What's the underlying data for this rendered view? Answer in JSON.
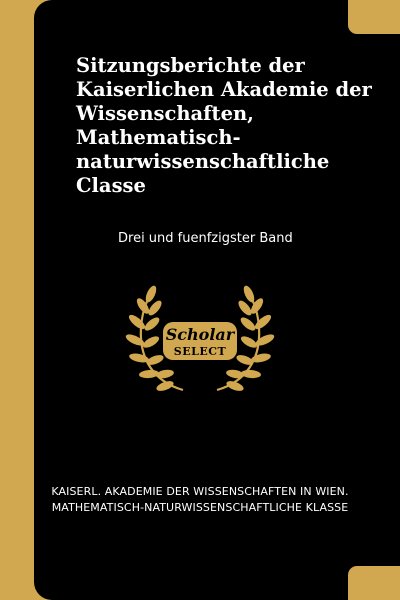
{
  "book": {
    "title": "Sitzungsberichte der\nKaiserlichen Akademie der\nWissenschaften,\nMathematisch-\nnaturwissenschaftliche\nClasse",
    "subtitle": "Drei und fuenfzigster Band",
    "author_line1": "KAISERL. AKADEMIE DER WISSENSCHAFTEN IN WIEN.",
    "author_line2": "MATHEMATISCH-NATURWISSENSCHAFTLICHE KLASSE"
  },
  "logo": {
    "word1": "Scholar",
    "word2": "SELECT"
  },
  "colors": {
    "background": "#000000",
    "gold": "#d1a84f",
    "text": "#ffffff"
  }
}
